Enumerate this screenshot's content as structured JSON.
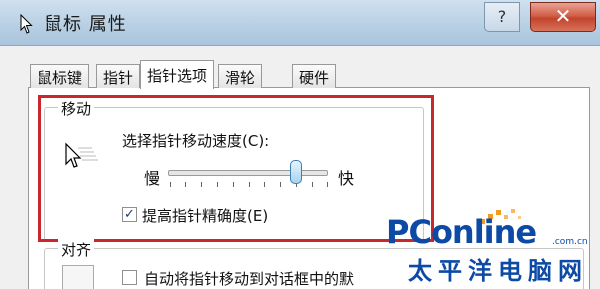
{
  "window": {
    "title": "鼠标 属性",
    "help_label": "?",
    "close_label": "✕"
  },
  "tabs": [
    {
      "label": "鼠标键"
    },
    {
      "label": "指针"
    },
    {
      "label": "指针选项"
    },
    {
      "label": "滑轮"
    },
    {
      "label": "硬件"
    }
  ],
  "motion": {
    "group_label": "移动",
    "speed_label": "选择指针移动速度(C):",
    "slow_label": "慢",
    "fast_label": "快",
    "speed_value": 0.8,
    "precision_checked": true,
    "precision_label": "提高指针精确度(E)"
  },
  "snap": {
    "group_label": "对齐",
    "checked": false,
    "label": "自动将指针移动到对话框中的默"
  },
  "watermark": {
    "brand": "PConline",
    "domain": ".com.cn",
    "chinese": "太平洋电脑网"
  },
  "colors": {
    "highlight_border": "#c8282c",
    "watermark_blue": "#0c4aa5",
    "close_red": "#c2442c"
  }
}
